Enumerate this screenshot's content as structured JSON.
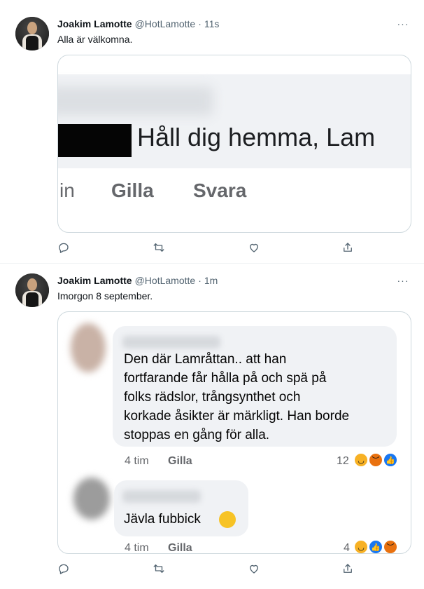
{
  "tweets": [
    {
      "author_name": "Joakim Lamotte",
      "handle": "@HotLamotte",
      "separator": "·",
      "time": "11s",
      "more": "···",
      "text": "Alla är välkomna.",
      "card": {
        "headline": "Håll dig hemma, Lam",
        "fb_in": "in",
        "fb_like": "Gilla",
        "fb_reply": "Svara"
      }
    },
    {
      "author_name": "Joakim Lamotte",
      "handle": "@HotLamotte",
      "separator": "·",
      "time": "1m",
      "more": "···",
      "text": "Imorgon 8 september.",
      "card": {
        "comments": [
          {
            "lines": [
              "Den där Lamråttan.. att han",
              "fortfarande får hålla på och spä på",
              "folks rädslor, trångsynthet och",
              "korkade åsikter är märkligt. Han borde",
              "stoppas en gång för alla."
            ],
            "age": "4 tim",
            "like": "Gilla",
            "reaction_count": "12"
          },
          {
            "lines": [
              "Jävla fubbick"
            ],
            "age": "4 tim",
            "like": "Gilla",
            "reaction_count": "4"
          }
        ]
      }
    }
  ],
  "icons": {
    "reply": "reply-icon",
    "retweet": "retweet-icon",
    "like": "like-icon",
    "share": "share-icon"
  },
  "colors": {
    "muted": "#536471",
    "border": "#cfd9de",
    "fb_bubble": "#f0f2f5",
    "fb_like_blue": "#1877f2"
  }
}
